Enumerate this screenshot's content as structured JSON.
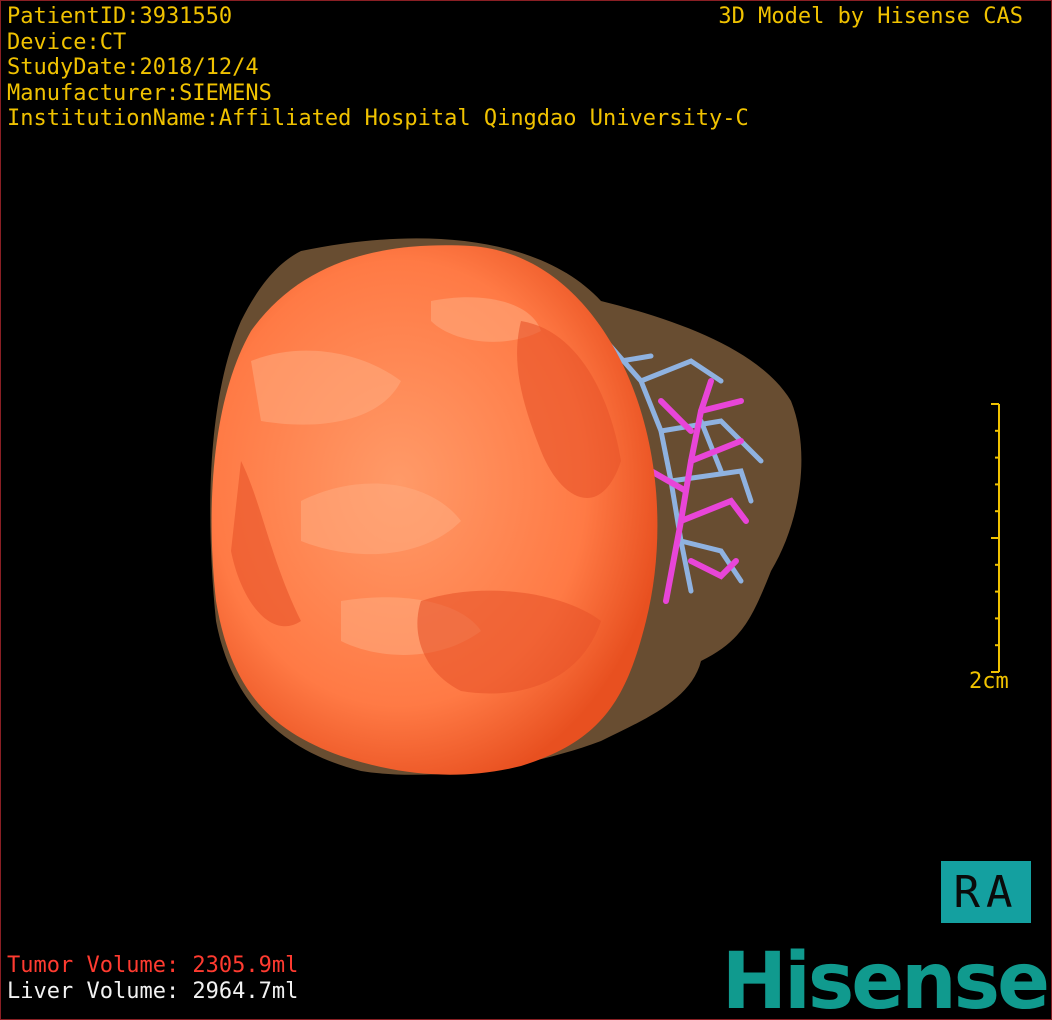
{
  "patient_info": {
    "patient_id": "PatientID:3931550",
    "device": "Device:CT",
    "study_date": "StudyDate:2018/12/4",
    "manufacturer": "Manufacturer:SIEMENS",
    "institution": "InstitutionName:Affiliated Hospital Qingdao University-C"
  },
  "credit": "3D Model by Hisense CAS",
  "volumes": {
    "tumor": "Tumor Volume: 2305.9ml",
    "liver": "Liver Volume: 2964.7ml"
  },
  "scale": {
    "label": "2cm"
  },
  "orientation": "RA",
  "brand": "Hisense",
  "colors": {
    "text": "#f0c200",
    "tumor_text": "#ff3b30",
    "tumor": "#ff6a3a",
    "liver": "#8a6a45",
    "vessel_portal": "#e845d8",
    "vessel_hepatic": "#8fb2e0",
    "badge": "#14a0a0",
    "brand": "#109a8e",
    "border": "#8a1f24"
  }
}
